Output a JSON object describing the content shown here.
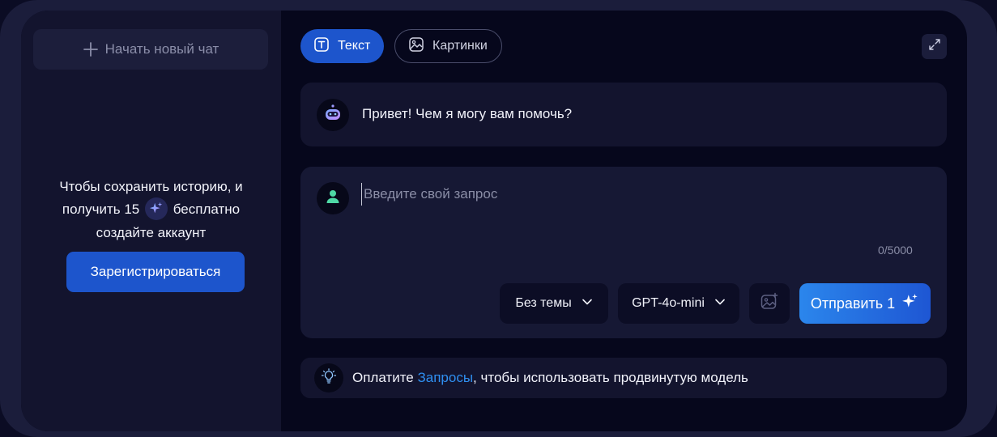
{
  "sidebar": {
    "new_chat_label": "Начать новый чат",
    "promo_line1": "Чтобы сохранить историю, и",
    "promo_line2_prefix": "получить 15",
    "promo_line2_suffix": "бесплатно",
    "promo_line3": "создайте аккаунт",
    "register_label": "Зарегистрироваться",
    "icons": {
      "new_chat": "plus-icon",
      "promo_badge": "sparkle-icon"
    }
  },
  "tabs": [
    {
      "label": "Текст",
      "icon": "text-icon",
      "active": true
    },
    {
      "label": "Картинки",
      "icon": "image-icon",
      "active": false
    }
  ],
  "expand_icon": "expand-icon",
  "bot_message": {
    "text": "Привет! Чем я могу вам помочь?",
    "avatar_icon": "robot-icon"
  },
  "composer": {
    "avatar_icon": "user-icon",
    "placeholder": "Введите свой запрос",
    "value": "",
    "counter": "0/5000",
    "theme_select": "Без темы",
    "model_select": "GPT-4o-mini",
    "image_upload_icon": "image-add-icon",
    "send_label": "Отправить 1",
    "send_icon": "sparkle-icon"
  },
  "banner": {
    "prefix": "Оплатите ",
    "link": "Запросы",
    "suffix": ", чтобы использовать продвинутую модель",
    "icon": "lightbulb-icon"
  },
  "colors": {
    "accent": "#1d55cc",
    "link": "#2f8ff0",
    "background": "#06071c",
    "sidebar": "#13142e",
    "card": "#161834"
  }
}
